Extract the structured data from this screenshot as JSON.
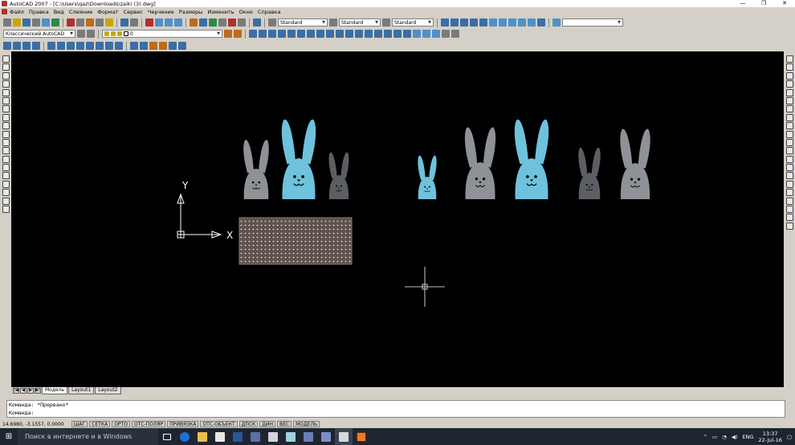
{
  "window": {
    "title": "AutoCAD 2007 - [C:\\Users\\qaz\\Downloads\\zaiki (3).dwg]",
    "minimize": "—",
    "maximize": "❐",
    "close": "✕"
  },
  "menu": [
    "Файл",
    "Правка",
    "Вид",
    "Слияние",
    "Формат",
    "Сервис",
    "Черчение",
    "Размеры",
    "Изменить",
    "Окно",
    "Справка"
  ],
  "toolbar": {
    "text_style": "Standard",
    "dim_style": "Standard",
    "table_style": "Standard",
    "workspace": "Классический AutoCAD",
    "layer": "0"
  },
  "canvas": {
    "bg": "#000000",
    "ucs_y": "Y",
    "ucs_x": "X"
  },
  "layout_tabs": [
    "Модель",
    "Layout1",
    "Layout2"
  ],
  "tab_nav": [
    "|◀",
    "◀",
    "▶",
    "▶|"
  ],
  "command": {
    "line1": "Команда: *Прервано*",
    "line2": "Команда:"
  },
  "status": {
    "coords": "14.6980, -3.1557, 0.0000",
    "buttons": [
      "ШАГ",
      "СЕТКА",
      "ОРТО",
      "ОТС-ПОЛЯР",
      "ПРИВЯЗКА",
      "ОТС-ОБЪЕКТ",
      "ДПСК",
      "ДИН",
      "ВЕС",
      "МОДЕЛЬ"
    ]
  },
  "taskbar": {
    "search": "Поиск в интернете и в Windows",
    "lang": "ENG",
    "time": "13:37",
    "date": "22-Jul-16"
  },
  "colors": {
    "bunny_blue": "#6ec2dc",
    "bunny_gray": "#8e9296",
    "bunny_dark": "#5b5f63"
  }
}
